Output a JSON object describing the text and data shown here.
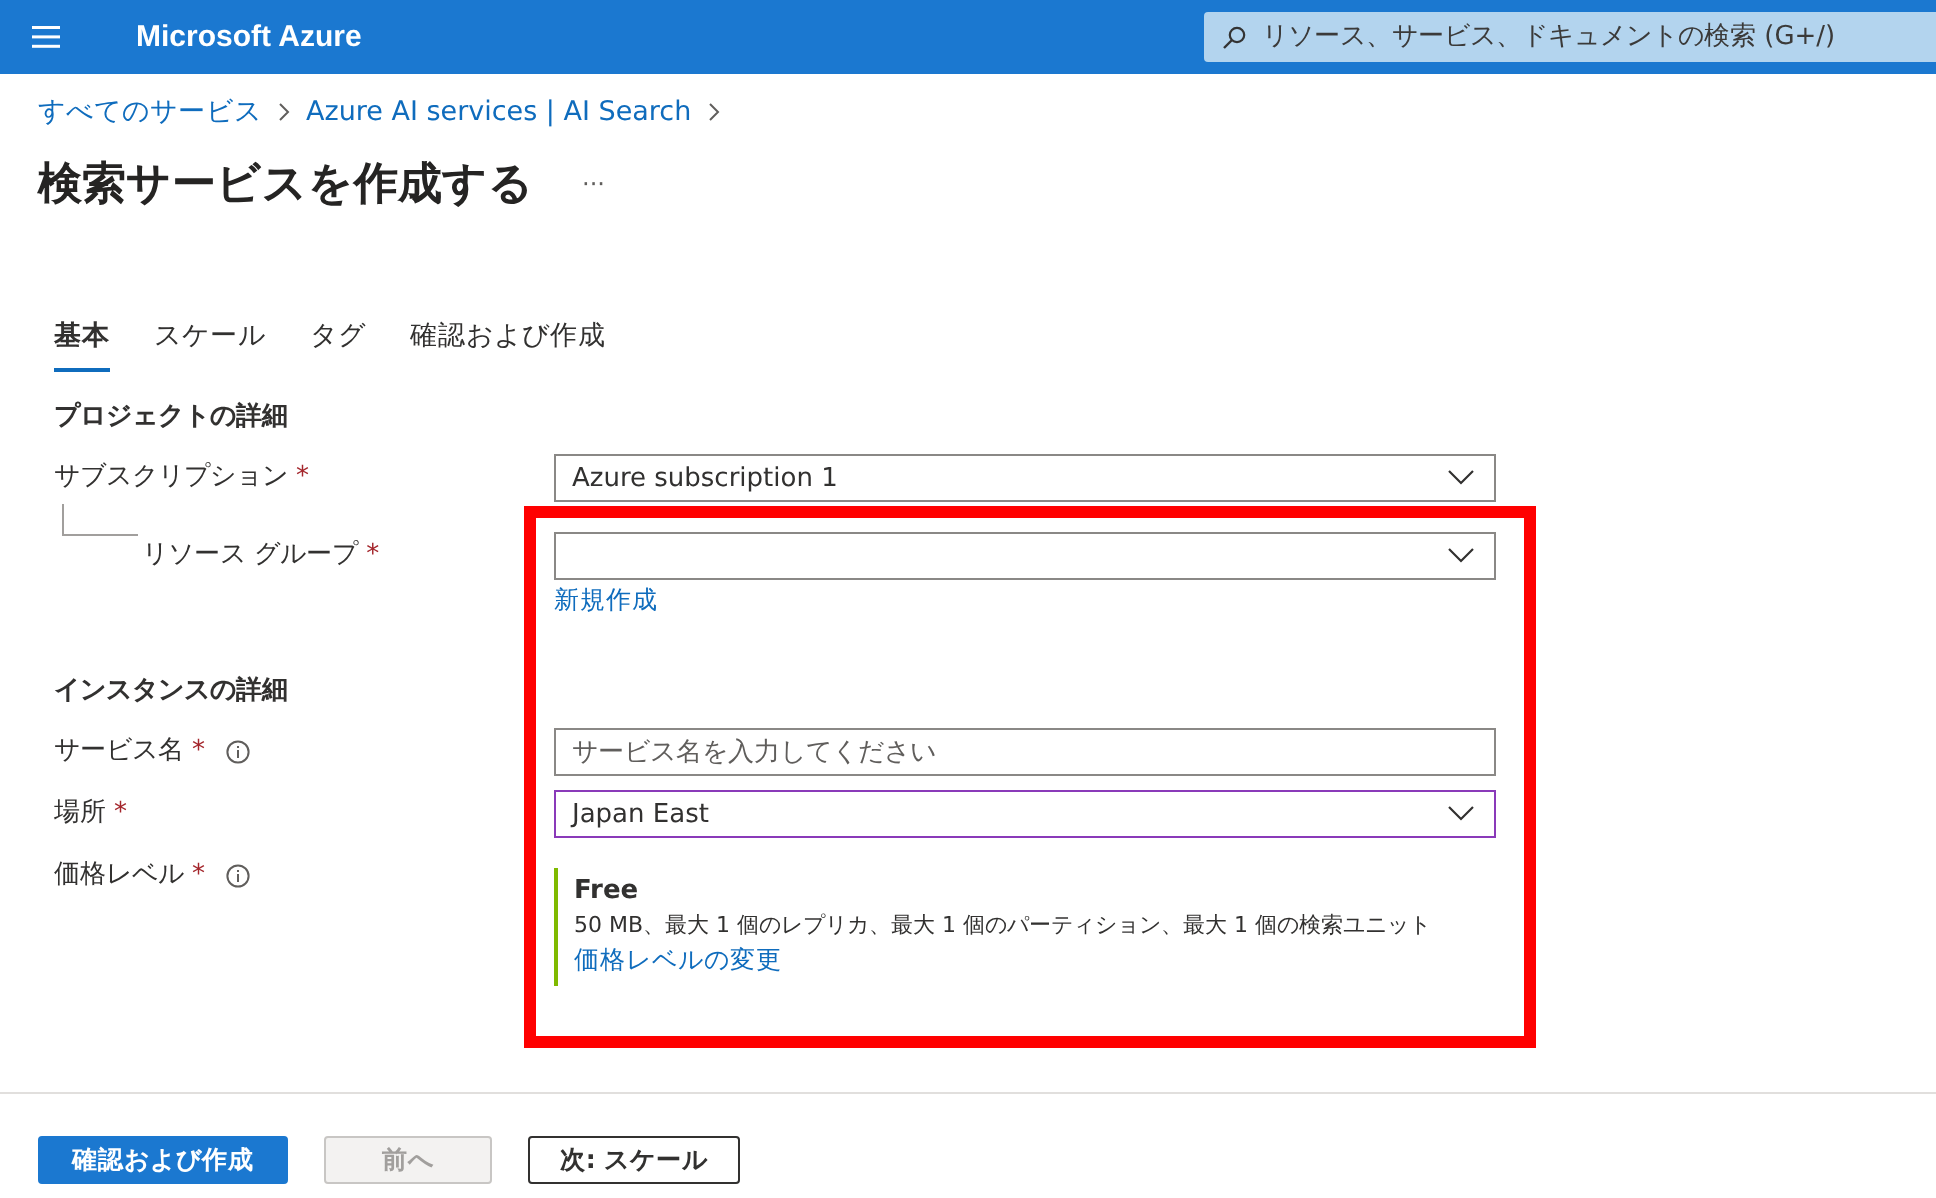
{
  "header": {
    "brand": "Microsoft Azure",
    "search": {
      "placeholder": "リソース、サービス、ドキュメントの検索 (G+/)"
    }
  },
  "breadcrumb": [
    "すべてのサービス",
    "Azure AI services | AI Search"
  ],
  "title": "検索サービスを作成する",
  "more": "···",
  "tabs": [
    {
      "label": "基本",
      "selected": true
    },
    {
      "label": "スケール",
      "selected": false
    },
    {
      "label": "タグ",
      "selected": false
    },
    {
      "label": "確認および作成",
      "selected": false
    }
  ],
  "sections": [
    {
      "heading": "プロジェクトの詳細",
      "fields": [
        {
          "label": "サブスクリプション",
          "required_mark": "*",
          "kind": "select",
          "value": "Azure subscription 1",
          "highlighted": false,
          "children": [
            {
              "label": "リソース グループ",
              "required_mark": "*",
              "kind": "select",
              "highlighted": false,
              "link": "新規作成"
            }
          ]
        }
      ]
    },
    {
      "heading": "インスタンスの詳細",
      "fields": [
        {
          "label": "サービス名",
          "required_mark": "*",
          "info": true,
          "kind": "text",
          "placeholder": "サービス名を入力してください",
          "highlighted": false
        },
        {
          "label": "場所",
          "required_mark": "*",
          "kind": "select",
          "value": "Japan East",
          "highlighted": true
        },
        {
          "label": "価格レベル",
          "required_mark": "*",
          "info": true,
          "kind": "tier",
          "tier": "Free",
          "description": "50 MB、最大 1 個のレプリカ、最大 1 個のパーティション、最大 1 個の検索ユニット",
          "link": "価格レベルの変更"
        }
      ]
    }
  ],
  "buttons": [
    {
      "label": "確認および作成",
      "kind": "primary",
      "disabled": false
    },
    {
      "label": "前へ",
      "kind": "secondary",
      "disabled": true
    },
    {
      "label": "次: スケール",
      "kind": "secondary",
      "disabled": false
    }
  ]
}
